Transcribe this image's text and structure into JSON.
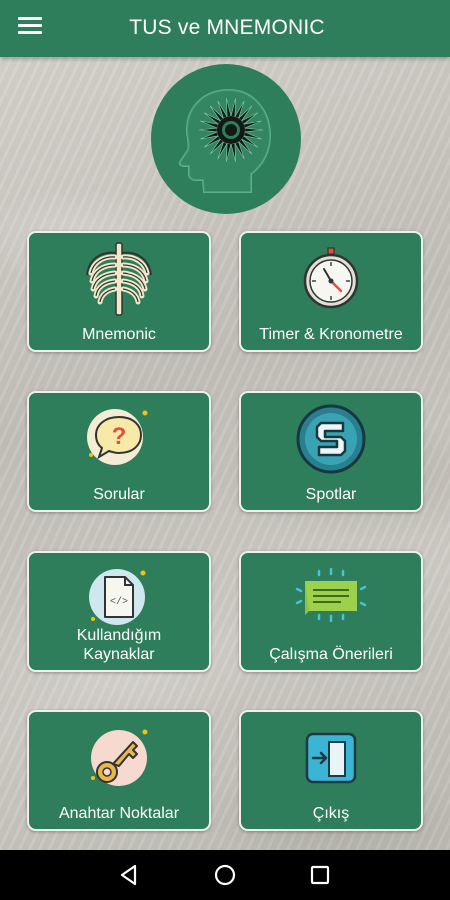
{
  "app_bar": {
    "title": "TUS ve MNEMONIC",
    "menu_icon": "hamburger-menu-icon"
  },
  "logo": {
    "icon": "brain-head-logo-icon",
    "color": "#2e7d5b"
  },
  "menu": [
    {
      "id": "mnemonic",
      "label": "Mnemonic",
      "icon": "ribcage-icon"
    },
    {
      "id": "timer",
      "label": "Timer & Kronometre",
      "icon": "stopwatch-icon"
    },
    {
      "id": "sorular",
      "label": "Sorular",
      "icon": "question-bubble-icon"
    },
    {
      "id": "spotlar",
      "label": "Spotlar",
      "icon": "s-badge-icon"
    },
    {
      "id": "kaynaklar",
      "label": "Kullandığım Kaynaklar",
      "icon": "code-document-icon"
    },
    {
      "id": "oneriler",
      "label": "Çalışma Önerileri",
      "icon": "announcement-message-icon"
    },
    {
      "id": "anahtar",
      "label": "Anahtar Noktalar",
      "icon": "key-icon"
    },
    {
      "id": "cikis",
      "label": "Çıkış",
      "icon": "exit-door-icon"
    }
  ],
  "navigation_bar": {
    "back": "back-icon",
    "home": "home-icon",
    "recents": "recents-icon"
  },
  "colors": {
    "primary": "#2e7d5b",
    "card_border": "#f0f0ea",
    "nav_background": "#000000"
  }
}
